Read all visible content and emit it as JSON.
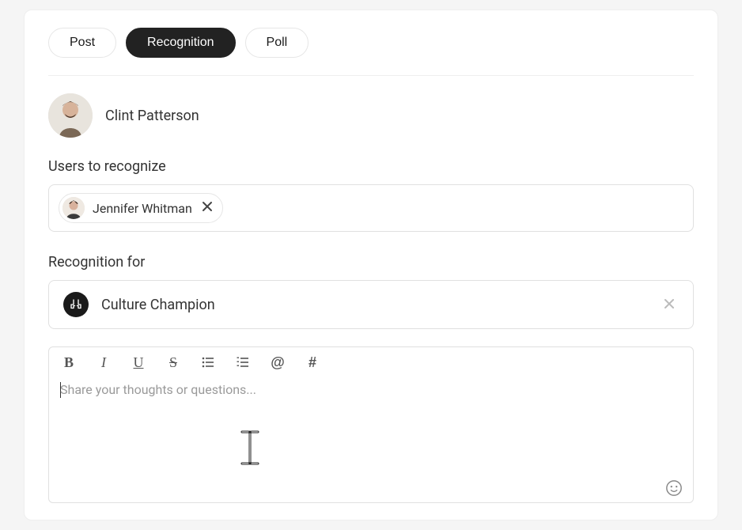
{
  "tabs": {
    "post": "Post",
    "recognition": "Recognition",
    "poll": "Poll"
  },
  "author": {
    "name": "Clint Patterson"
  },
  "users_to_recognize": {
    "label": "Users to recognize",
    "chips": [
      {
        "name": "Jennifer Whitman"
      }
    ]
  },
  "recognition_for": {
    "label": "Recognition for",
    "selected": "Culture Champion"
  },
  "editor": {
    "placeholder": "Share your thoughts or questions...",
    "toolbar": {
      "bold": "B",
      "italic": "I",
      "underline": "U",
      "strike": "S",
      "at": "@",
      "hash": "#"
    }
  }
}
